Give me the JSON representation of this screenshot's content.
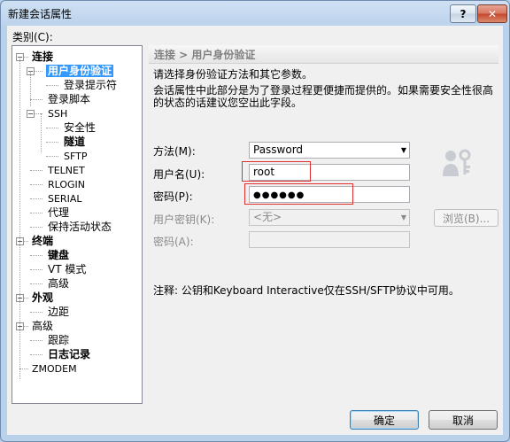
{
  "window": {
    "title": "新建会话属性",
    "help_glyph": "?",
    "close_glyph": "✕"
  },
  "category_label": "类别(C):",
  "tree": [
    {
      "label": "连接",
      "bold": true,
      "toggle": "−"
    },
    {
      "label": "用户身份验证",
      "bold": true,
      "toggle": "−",
      "selected": true
    },
    {
      "label": "登录提示符"
    },
    {
      "label": "登录脚本"
    },
    {
      "label": "SSH",
      "toggle": "−",
      "small": true
    },
    {
      "label": "安全性"
    },
    {
      "label": "隧道",
      "bold": true
    },
    {
      "label": "SFTP",
      "small": true
    },
    {
      "label": "TELNET",
      "small": true
    },
    {
      "label": "RLOGIN",
      "small": true
    },
    {
      "label": "SERIAL",
      "small": true
    },
    {
      "label": "代理"
    },
    {
      "label": "保持活动状态"
    },
    {
      "label": "终端",
      "bold": true,
      "toggle": "−"
    },
    {
      "label": "键盘",
      "bold": true
    },
    {
      "label": "VT 模式"
    },
    {
      "label": "高级"
    },
    {
      "label": "外观",
      "bold": true,
      "toggle": "−"
    },
    {
      "label": "边距"
    },
    {
      "label": "高级",
      "toggle": "−"
    },
    {
      "label": "跟踪"
    },
    {
      "label": "日志记录",
      "bold": true
    },
    {
      "label": "ZMODEM",
      "small": true
    }
  ],
  "section_header": "连接 > 用户身份验证",
  "desc": {
    "line1": "请选择身份验证方法和其它参数。",
    "line2": "会话属性中此部分是为了登录过程更便捷而提供的。如果需要安全性很高",
    "line3": "的状态的话建议您空出此字段。"
  },
  "form": {
    "method_label": "方法(M):",
    "method_value": "Password",
    "username_label": "用户名(U):",
    "username_value": "root",
    "password_label": "密码(P):",
    "password_value": "●●●●●●",
    "userkey_label": "用户密钥(K):",
    "userkey_value": "<无>",
    "browse_label": "浏览(B)...",
    "passphrase_label": "密码(A):"
  },
  "note": "注释: 公钥和Keyboard Interactive仅在SSH/SFTP协议中可用。",
  "buttons": {
    "ok": "确定",
    "cancel": "取消"
  },
  "colors": {
    "selection": "#3399ff",
    "highlight_box": "#e03030"
  }
}
